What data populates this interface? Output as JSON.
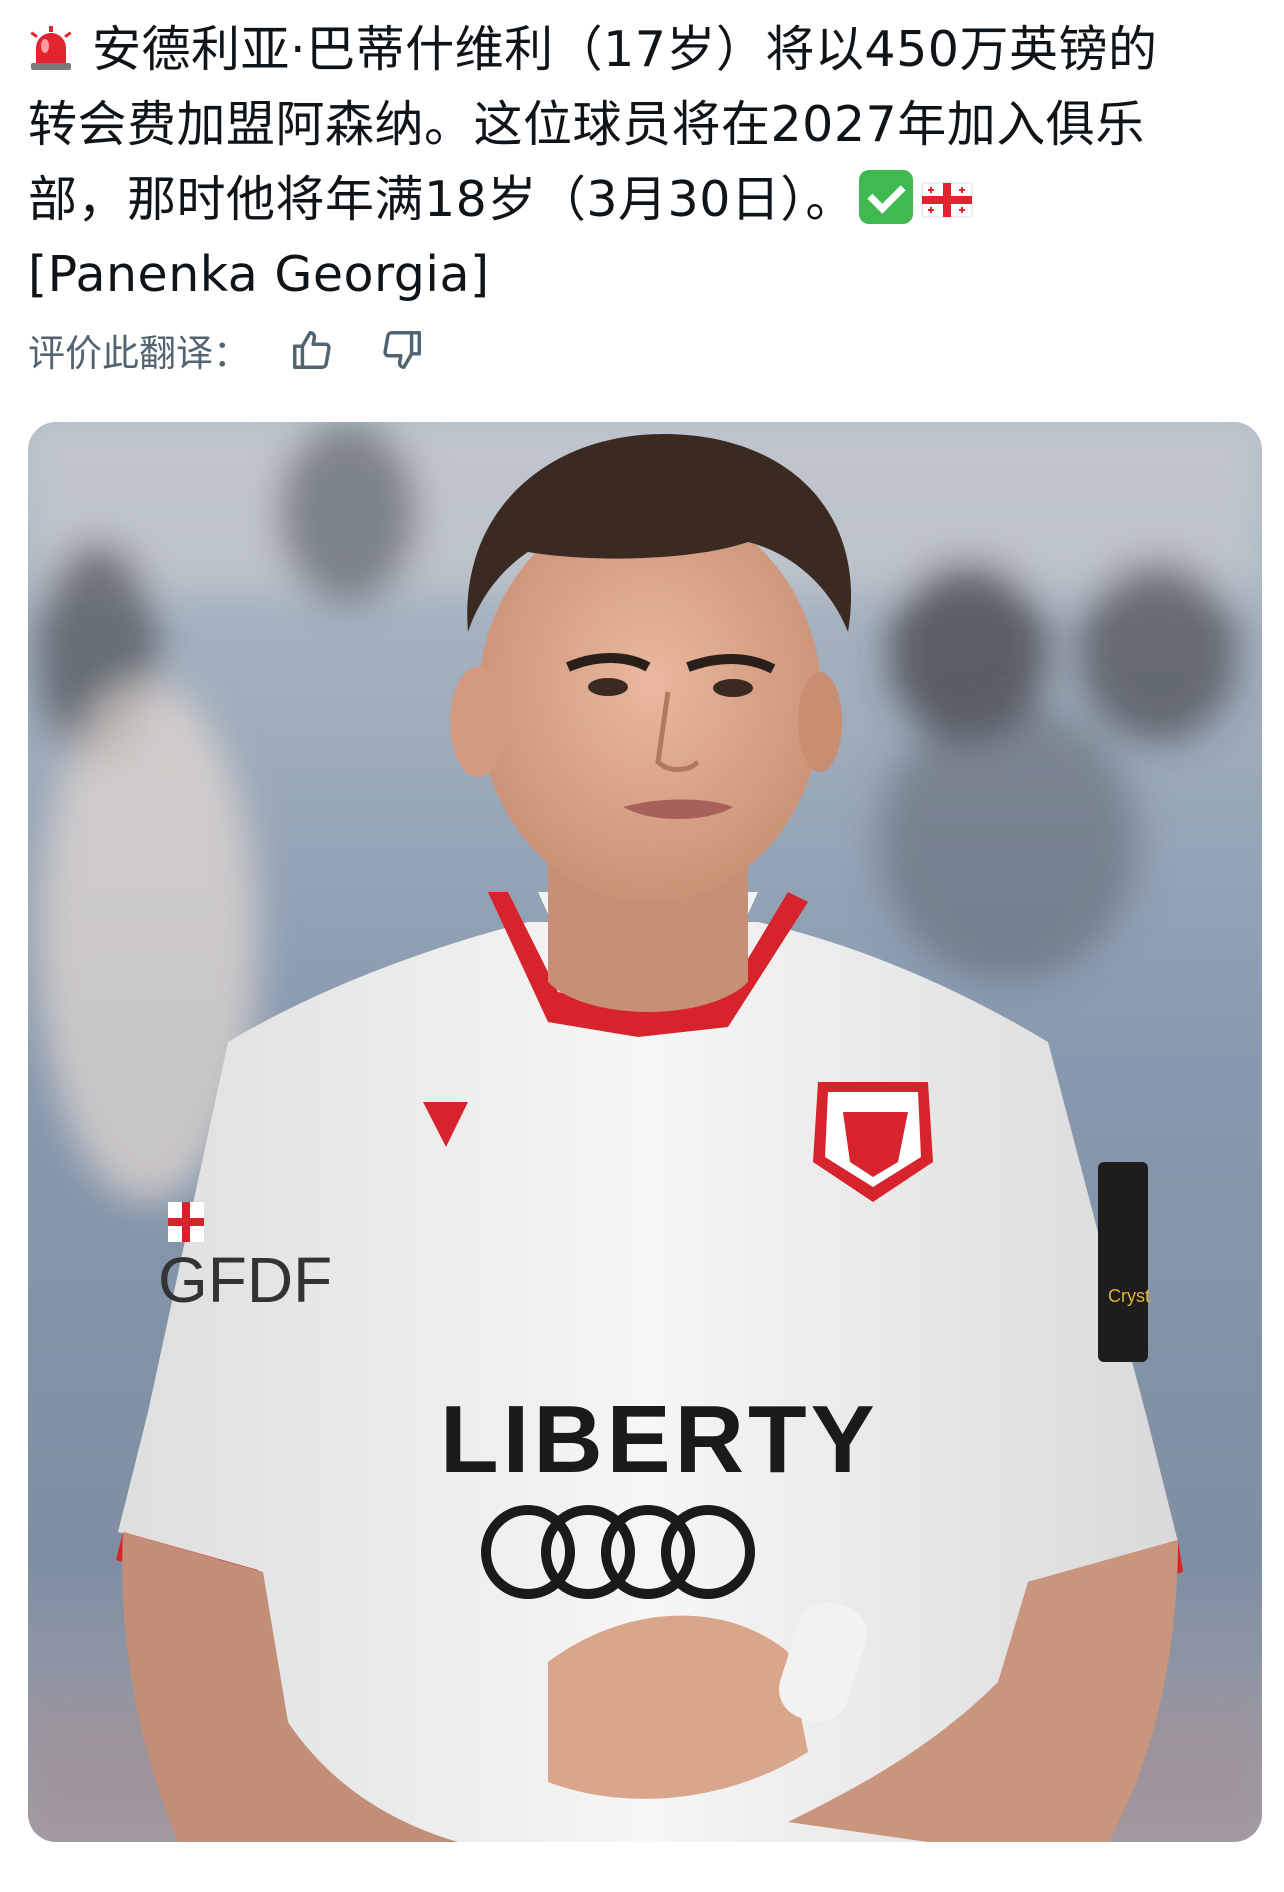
{
  "post": {
    "text_line1": "安德利亚·巴蒂什维利（17岁）将以450万英镑的",
    "text_line2": "转会费加盟阿森纳。这位球员将在2027年加入俱乐",
    "text_line3": "部，那时他将年满18岁（3月30日）。",
    "text_line4": "[Panenka Georgia]",
    "leading_emoji": "police-light-icon",
    "trailing_emoji": [
      "check-mark-icon",
      "georgia-flag-icon"
    ]
  },
  "translation_rating": {
    "label": "评价此翻译："
  },
  "photo": {
    "shirt_sponsor": "LIBERTY",
    "sleeve_text": "GFDF",
    "patch_text": "Cryst"
  },
  "colors": {
    "text": "#0f1419",
    "secondary_text": "#536471",
    "accent_red": "#d7242c"
  }
}
